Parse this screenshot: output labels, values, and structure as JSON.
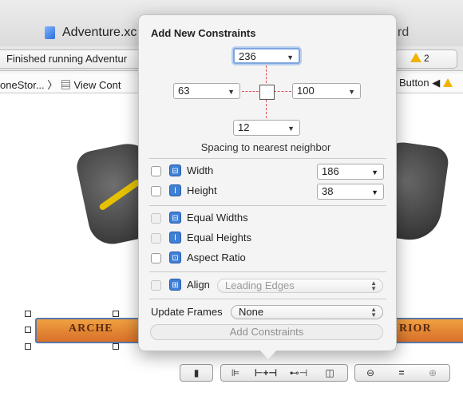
{
  "window": {
    "title": "Adventure.xc",
    "title_right": "rd"
  },
  "status": {
    "text": "Finished running Adventur",
    "warnings": "2"
  },
  "jumpbar": {
    "left": "oneStor... 〉 ▤ View Cont",
    "right": "Button ◀ "
  },
  "canvas": {
    "archer_label": "Arche",
    "warrior_label": "rior"
  },
  "popover": {
    "title": "Add New Constraints",
    "top_value": "236",
    "left_value": "63",
    "right_value": "100",
    "bottom_value": "12",
    "spacing_label": "Spacing to nearest neighbor",
    "width_label": "Width",
    "width_value": "186",
    "height_label": "Height",
    "height_value": "38",
    "equal_widths_label": "Equal Widths",
    "equal_heights_label": "Equal Heights",
    "aspect_ratio_label": "Aspect Ratio",
    "align_label": "Align",
    "align_value": "Leading Edges",
    "update_frames_label": "Update Frames",
    "update_frames_value": "None",
    "add_button": "Add Constraints"
  },
  "toolbar": {
    "icons": [
      "resolve-icon",
      "align-icon",
      "pin-icon",
      "resizing-icon",
      "embed-icon",
      "zoom-out-icon",
      "zoom-fit-icon",
      "zoom-in-icon"
    ]
  },
  "colors": {
    "accent": "#3f7fd6",
    "warning": "#f0b400",
    "button_orange": "#e08a36"
  }
}
